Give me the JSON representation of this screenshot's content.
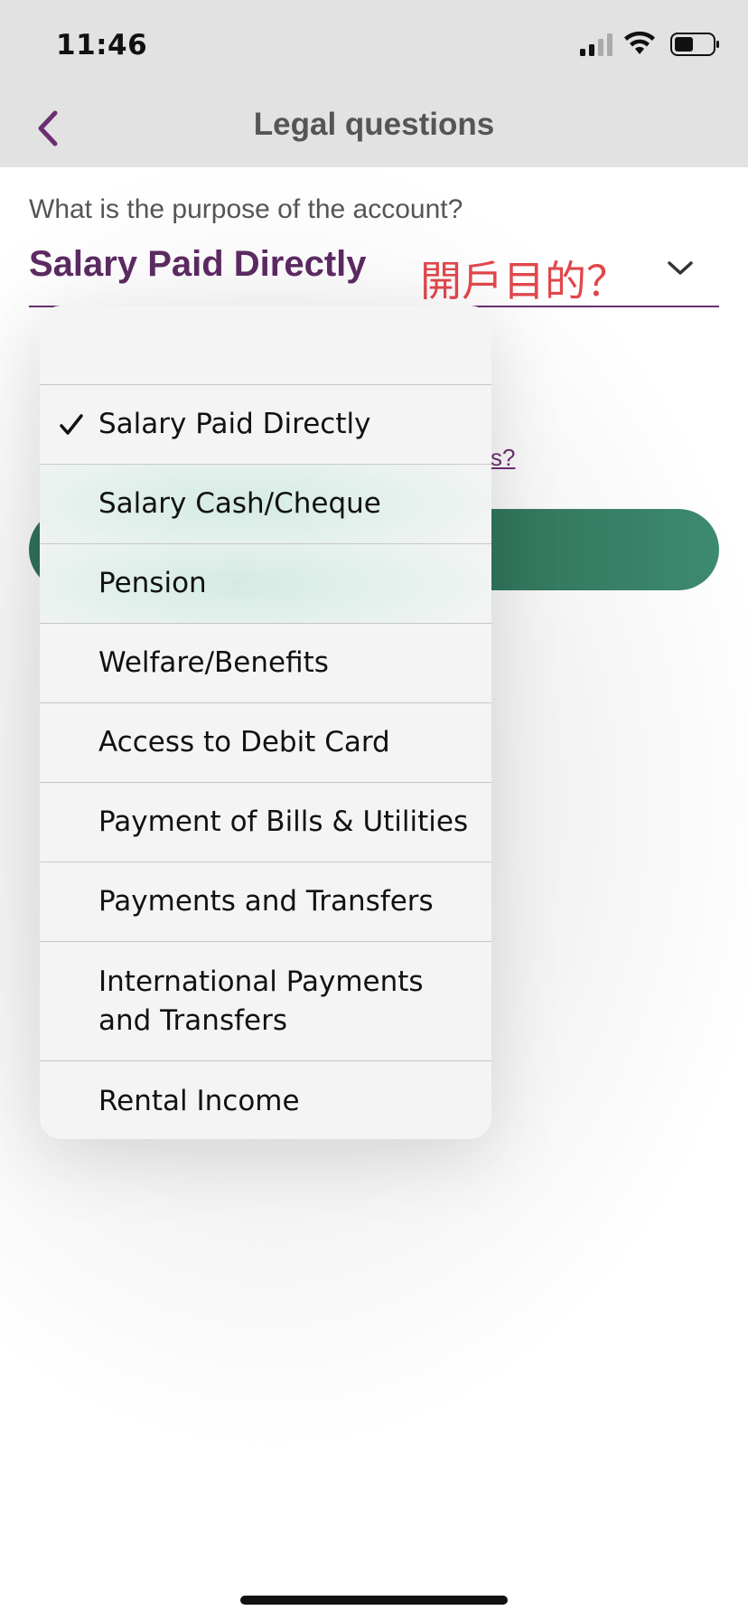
{
  "status_bar": {
    "time": "11:46"
  },
  "nav": {
    "title": "Legal questions",
    "back_icon": "chevron-left-icon"
  },
  "form": {
    "question": "What is the purpose of the account?",
    "selected_value": "Salary Paid Directly",
    "annotation": "開戶目的？",
    "link_fragment": "s?"
  },
  "menu": {
    "items": [
      {
        "label": "",
        "checked": false
      },
      {
        "label": "Salary Paid Directly",
        "checked": true
      },
      {
        "label": "Salary Cash/Cheque",
        "checked": false
      },
      {
        "label": "Pension",
        "checked": false
      },
      {
        "label": "Welfare/Benefits",
        "checked": false
      },
      {
        "label": "Access to Debit Card",
        "checked": false
      },
      {
        "label": "Payment of Bills & Utilities",
        "checked": false
      },
      {
        "label": "Payments and Transfers",
        "checked": false
      },
      {
        "label": "International Payments and Transfers",
        "checked": false
      },
      {
        "label": "Rental Income",
        "checked": false
      }
    ]
  },
  "colors": {
    "accent": "#5c2a62",
    "button": "#2f6f56",
    "annotation": "#e0474c"
  }
}
